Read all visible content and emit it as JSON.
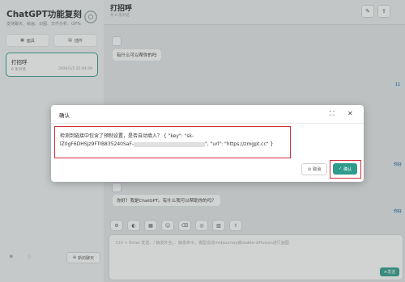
{
  "sidebar": {
    "brand": "ChatGPT功能复刻",
    "tagline": "支持聊天、绘画、识图、文件分析、GPTs",
    "mask_label": "面具",
    "plugin_label": "插件",
    "chats": [
      {
        "title": "打招呼",
        "count": "6 条对话",
        "date": "2024/1/2 22:44:28"
      }
    ],
    "new_chat_label": "新的聊天"
  },
  "header": {
    "title": "打招呼",
    "subtitle": "共 6 条对话"
  },
  "messages": [
    {
      "text": "有什么可以帮你的吗"
    },
    {
      "text": "你好！我是ChatGPT。有什么我可以帮助你的吗？"
    }
  ],
  "side_chips": [
    "11",
    "你好",
    "你好"
  ],
  "composer": {
    "placeholder": "Ctrl + Enter 发送，/ 触发补全，：触发命令，模型设成midjourney或stable-diffusion进行画图",
    "send_label": "发送"
  },
  "modal": {
    "title": "确认",
    "message_lead": "检测到链接中包含了预制设置，是否自动填入？ { \"key\": \"sk-",
    "message_key_part": "lZ0gF6DHSJz9FTrB835240SaF-",
    "message_tail": "\", \"url\": \"https://zmgpt.cc\" }",
    "cancel_label": "取消",
    "confirm_label": "确认"
  },
  "colors": {
    "accent": "#2f9b8a",
    "highlight": "#d0303a"
  }
}
